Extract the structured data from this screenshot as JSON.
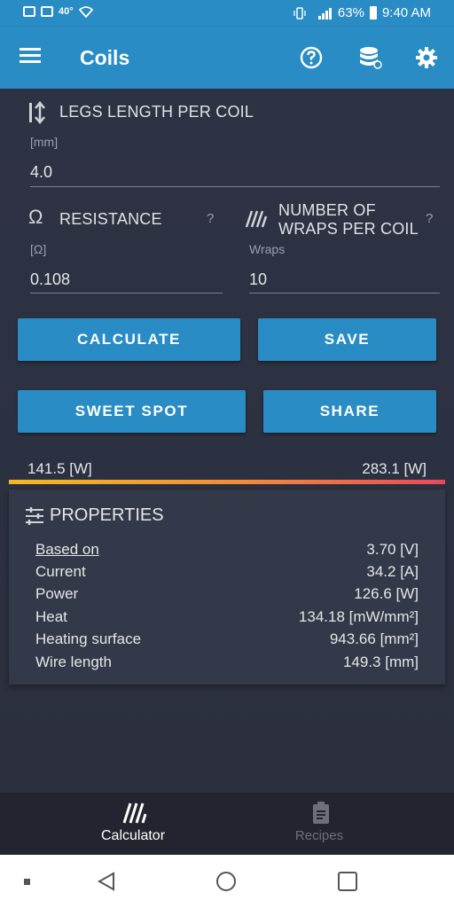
{
  "status_bar": {
    "temperature": "40°",
    "battery": "63%",
    "time": "9:40 AM"
  },
  "app_bar": {
    "title": "Coils",
    "actions": [
      "help-icon",
      "database-icon",
      "settings-icon"
    ]
  },
  "legs_length": {
    "label": "LEGS LENGTH PER COIL",
    "unit": "[mm]",
    "value": "4.0"
  },
  "resistance": {
    "label": "RESISTANCE",
    "help": "?",
    "unit": "[Ω]",
    "value": "0.108"
  },
  "wraps": {
    "label_line1": "NUMBER OF",
    "label_line2": "WRAPS PER COIL",
    "help": "?",
    "unit": "Wraps",
    "value": "10"
  },
  "buttons": {
    "calculate": "CALCULATE",
    "save": "SAVE",
    "sweet_spot": "SWEET SPOT",
    "share": "SHARE"
  },
  "range": {
    "min": "141.5 [W]",
    "max": "283.1 [W]"
  },
  "properties": {
    "title": "PROPERTIES",
    "rows": [
      {
        "key": "Based on",
        "value": "3.70 [V]"
      },
      {
        "key": "Current",
        "value": "34.2 [A]"
      },
      {
        "key": "Power",
        "value": "126.6 [W]"
      },
      {
        "key": "Heat",
        "value": "134.18 [mW/mm²]"
      },
      {
        "key": "Heating surface",
        "value": "943.66 [mm²]"
      },
      {
        "key": "Wire length",
        "value": "149.3 [mm]"
      }
    ]
  },
  "bottom_nav": {
    "items": [
      {
        "label": "Calculator",
        "active": true
      },
      {
        "label": "Recipes",
        "active": false
      }
    ]
  },
  "colors": {
    "accent": "#2a8cc4",
    "background": "#2c3040",
    "card": "#343949"
  }
}
